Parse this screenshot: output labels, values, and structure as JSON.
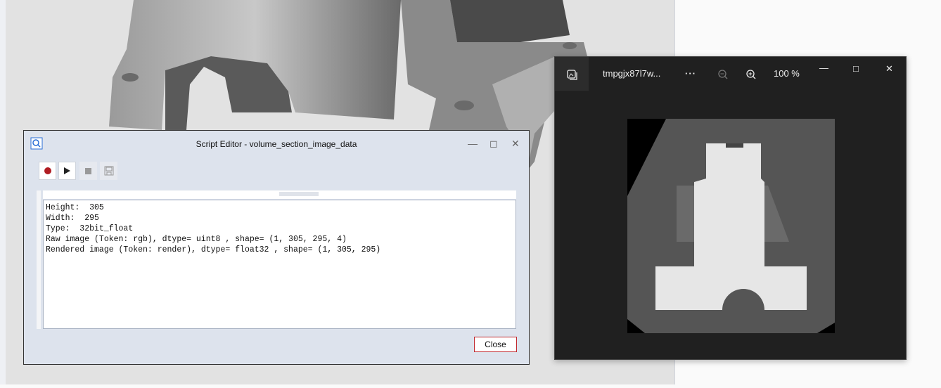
{
  "script_editor": {
    "title": "Script Editor - volume_section_image_data",
    "output_lines": [
      "Height:  305",
      "Width:  295",
      "Type:  32bit_float",
      "Raw image (Token: rgb), dtype= uint8 , shape= (1, 305, 295, 4)",
      "Rendered image (Token: render), dtype= float32 , shape= (1, 305, 295)"
    ],
    "close_label": "Close",
    "colors": {
      "record": "#b01c22",
      "close_border": "#c0272d"
    }
  },
  "photo_viewer": {
    "filename": "tmpgjx87l7w...",
    "more_label": "···",
    "zoom": "100 %"
  }
}
